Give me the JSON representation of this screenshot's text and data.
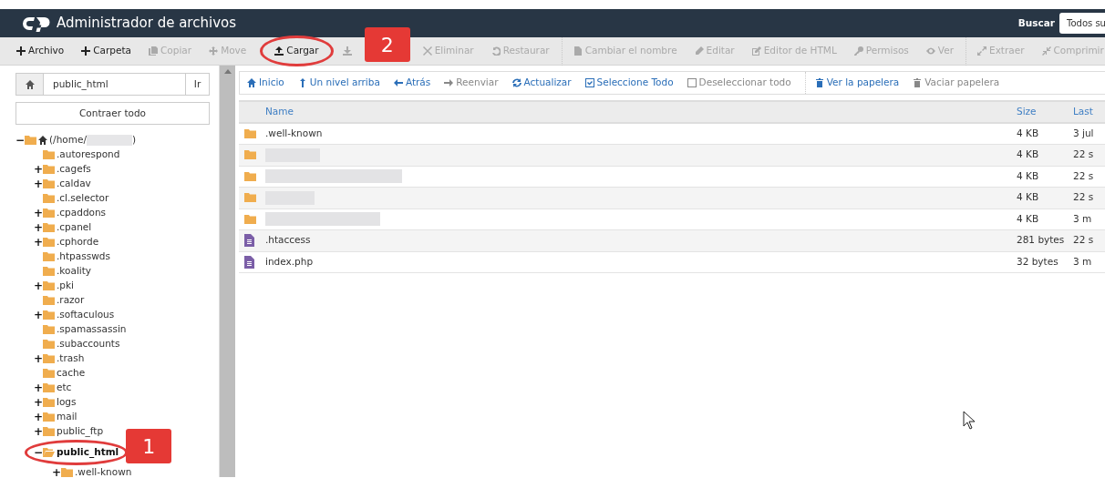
{
  "header": {
    "title": "Administrador de archivos",
    "search_label": "Buscar",
    "search_value": "Todos su"
  },
  "toolbar": [
    {
      "kind": "plus",
      "label": "Archivo",
      "disabled": false
    },
    {
      "kind": "plus",
      "label": "Carpeta",
      "disabled": false
    },
    {
      "kind": "copy",
      "label": "Copiar",
      "disabled": true
    },
    {
      "kind": "move",
      "label": "Move",
      "disabled": true
    },
    {
      "kind": "upload",
      "label": "Cargar",
      "disabled": false,
      "callout": "2"
    },
    {
      "kind": "download",
      "disabled": true
    },
    {
      "kind": "delete",
      "label": "Eliminar",
      "disabled": true
    },
    {
      "kind": "undo",
      "label": "Restaurar",
      "disabled": true,
      "separator_after": true
    },
    {
      "kind": "file",
      "label": "Cambiar el nombre",
      "disabled": true
    },
    {
      "kind": "pencil",
      "label": "Editar",
      "disabled": true
    },
    {
      "kind": "edit",
      "label": "Editor de HTML",
      "disabled": true
    },
    {
      "kind": "key",
      "label": "Permisos",
      "disabled": true
    },
    {
      "kind": "eye",
      "label": "Ver",
      "disabled": true,
      "separator_after": true
    },
    {
      "kind": "expand",
      "label": "Extraer",
      "disabled": true
    },
    {
      "kind": "compress",
      "label": "Comprimir",
      "disabled": true
    }
  ],
  "path_bar": {
    "value": "public_html",
    "go_label": "Ir"
  },
  "collapse_label": "Contraer todo",
  "tree": [
    {
      "label": "(/home/",
      "suffix": ")",
      "redacted": true,
      "home": true,
      "toggle": "−",
      "children": [
        {
          "label": ".autorespond"
        },
        {
          "label": ".cagefs",
          "toggle": "+"
        },
        {
          "label": ".caldav",
          "toggle": "+"
        },
        {
          "label": ".cl.selector"
        },
        {
          "label": ".cpaddons",
          "toggle": "+"
        },
        {
          "label": ".cpanel",
          "toggle": "+"
        },
        {
          "label": ".cphorde",
          "toggle": "+"
        },
        {
          "label": ".htpasswds"
        },
        {
          "label": ".koality"
        },
        {
          "label": ".pki",
          "toggle": "+"
        },
        {
          "label": ".razor"
        },
        {
          "label": ".softaculous",
          "toggle": "+"
        },
        {
          "label": ".spamassassin"
        },
        {
          "label": ".subaccounts"
        },
        {
          "label": ".trash",
          "toggle": "+"
        },
        {
          "label": "cache"
        },
        {
          "label": "etc",
          "toggle": "+"
        },
        {
          "label": "logs",
          "toggle": "+"
        },
        {
          "label": "mail",
          "toggle": "+"
        },
        {
          "label": "public_ftp",
          "toggle": "+"
        },
        {
          "label": "public_html",
          "toggle": "−",
          "selected": true,
          "callout": "1",
          "children": [
            {
              "label": ".well-known",
              "toggle": "+"
            }
          ]
        }
      ]
    }
  ],
  "nav": [
    {
      "kind": "home",
      "label": "Inicio",
      "disabled": false
    },
    {
      "kind": "up",
      "label": "Un nivel arriba",
      "disabled": false
    },
    {
      "kind": "left",
      "label": "Atrás",
      "disabled": false
    },
    {
      "kind": "right",
      "label": "Reenviar",
      "disabled": true
    },
    {
      "kind": "refresh",
      "label": "Actualizar",
      "disabled": false
    },
    {
      "kind": "checked",
      "label": "Seleccione Todo",
      "disabled": false
    },
    {
      "kind": "box",
      "label": "Deseleccionar todo",
      "disabled": true,
      "separator_after": true
    },
    {
      "kind": "trash",
      "label": "Ver la papelera",
      "disabled": false
    },
    {
      "kind": "trash",
      "label": "Vaciar papelera",
      "disabled": true
    }
  ],
  "table": {
    "columns": [
      "Name",
      "Size",
      "Last"
    ],
    "rows": [
      {
        "kind": "folder",
        "name": ".well-known",
        "size": "4 KB",
        "last": "3 jul"
      },
      {
        "kind": "folder",
        "redacted": true,
        "size": "4 KB",
        "last": "22 s"
      },
      {
        "kind": "folder",
        "redacted": true,
        "size": "4 KB",
        "last": "22 s"
      },
      {
        "kind": "folder",
        "redacted": true,
        "size": "4 KB",
        "last": "22 s"
      },
      {
        "kind": "folder",
        "redacted": true,
        "size": "4 KB",
        "last": "3 m"
      },
      {
        "kind": "file",
        "name": ".htaccess",
        "size": "281 bytes",
        "last": "22 s"
      },
      {
        "kind": "file",
        "name": "index.php",
        "size": "32 bytes",
        "last": "3 m"
      }
    ]
  }
}
